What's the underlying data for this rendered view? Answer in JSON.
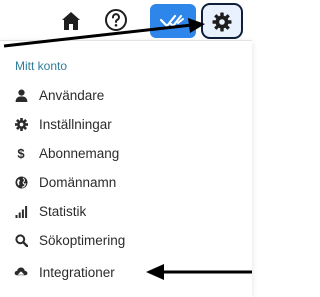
{
  "menu": {
    "header": "Mitt konto",
    "items": [
      {
        "label": "Användare",
        "icon": "user-icon"
      },
      {
        "label": "Inställningar",
        "icon": "gear-icon"
      },
      {
        "label": "Abonnemang",
        "icon": "dollar-icon"
      },
      {
        "label": "Domännamn",
        "icon": "globe-icon"
      },
      {
        "label": "Statistik",
        "icon": "bar-chart-icon"
      },
      {
        "label": "Sökoptimering",
        "icon": "search-icon"
      },
      {
        "label": "Integrationer",
        "icon": "cloud-upload-icon"
      }
    ]
  },
  "colors": {
    "accent": "#2f86ea",
    "header_text": "#2e7d9a",
    "gear_button_bg": "#e8f1fd",
    "annotation_arrow": "#000000"
  }
}
